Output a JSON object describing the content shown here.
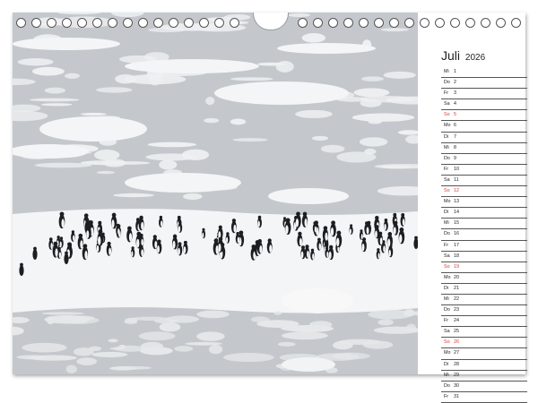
{
  "calendar": {
    "month": "Juli",
    "year": "2026",
    "days": [
      {
        "wd": "Mi",
        "d": "1",
        "sun": false
      },
      {
        "wd": "Do",
        "d": "2",
        "sun": false
      },
      {
        "wd": "Fr",
        "d": "3",
        "sun": false
      },
      {
        "wd": "Sa",
        "d": "4",
        "sun": false
      },
      {
        "wd": "So",
        "d": "5",
        "sun": true
      },
      {
        "wd": "Mo",
        "d": "6",
        "sun": false
      },
      {
        "wd": "Di",
        "d": "7",
        "sun": false
      },
      {
        "wd": "Mi",
        "d": "8",
        "sun": false
      },
      {
        "wd": "Do",
        "d": "9",
        "sun": false
      },
      {
        "wd": "Fr",
        "d": "10",
        "sun": false
      },
      {
        "wd": "Sa",
        "d": "11",
        "sun": false
      },
      {
        "wd": "So",
        "d": "12",
        "sun": true
      },
      {
        "wd": "Mo",
        "d": "13",
        "sun": false
      },
      {
        "wd": "Di",
        "d": "14",
        "sun": false
      },
      {
        "wd": "Mi",
        "d": "15",
        "sun": false
      },
      {
        "wd": "Do",
        "d": "16",
        "sun": false
      },
      {
        "wd": "Fr",
        "d": "17",
        "sun": false
      },
      {
        "wd": "Sa",
        "d": "18",
        "sun": false
      },
      {
        "wd": "So",
        "d": "19",
        "sun": true
      },
      {
        "wd": "Mo",
        "d": "20",
        "sun": false
      },
      {
        "wd": "Di",
        "d": "21",
        "sun": false
      },
      {
        "wd": "Mi",
        "d": "22",
        "sun": false
      },
      {
        "wd": "Do",
        "d": "23",
        "sun": false
      },
      {
        "wd": "Fr",
        "d": "24",
        "sun": false
      },
      {
        "wd": "Sa",
        "d": "25",
        "sun": false
      },
      {
        "wd": "So",
        "d": "26",
        "sun": true
      },
      {
        "wd": "Mo",
        "d": "27",
        "sun": false
      },
      {
        "wd": "Di",
        "d": "28",
        "sun": false
      },
      {
        "wd": "Mi",
        "d": "29",
        "sun": false
      },
      {
        "wd": "Do",
        "d": "30",
        "sun": false
      },
      {
        "wd": "Fr",
        "d": "31",
        "sun": false
      }
    ]
  },
  "colors": {
    "sunday": "#d23a3a",
    "ice": "#f4f5f6",
    "water": "#c4c8cc",
    "penguin": "#1d1e22"
  },
  "photo": {
    "icon": "penguins-on-ice-photo"
  }
}
